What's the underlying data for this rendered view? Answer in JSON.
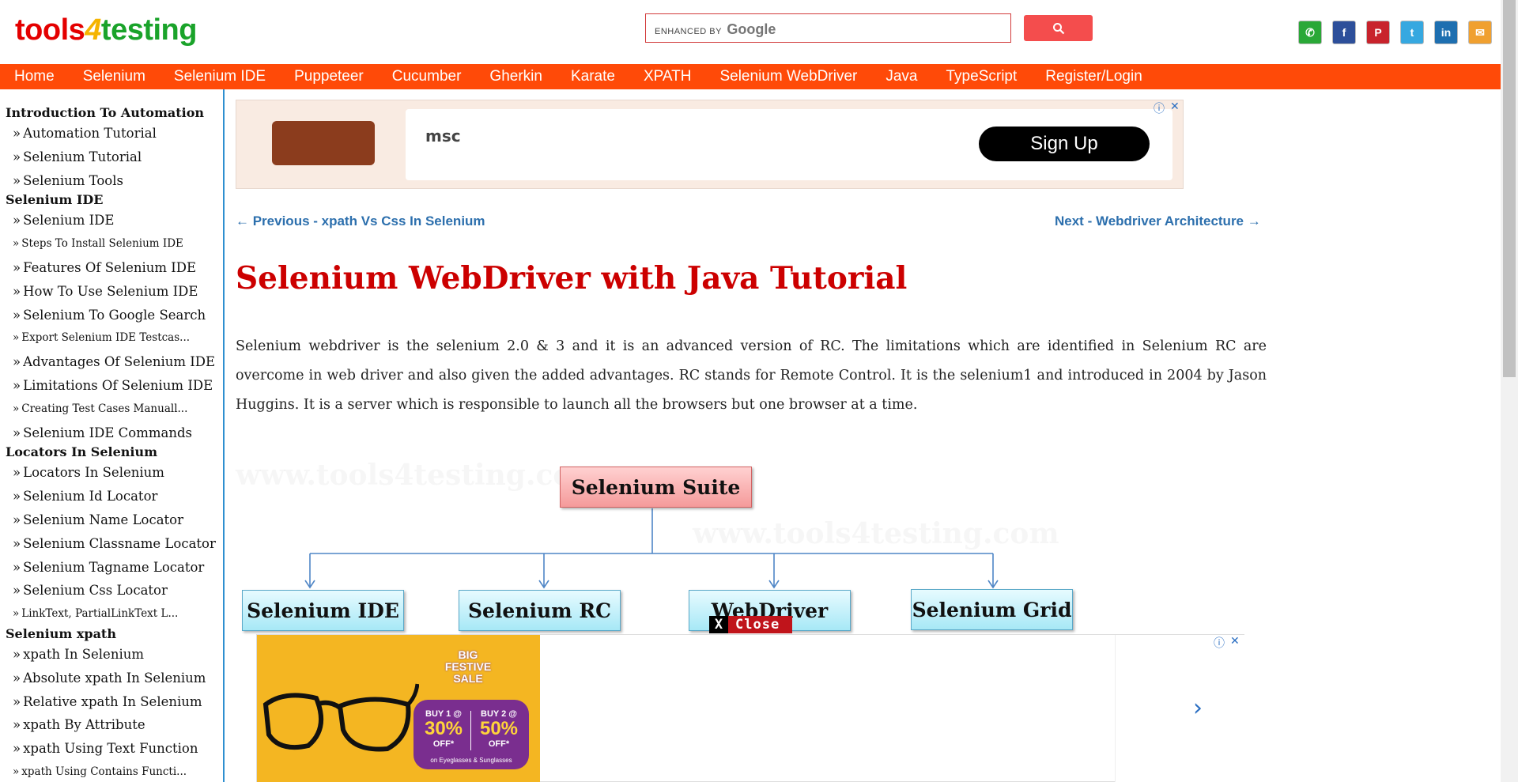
{
  "logo": {
    "part1": "tools",
    "part2": "4",
    "part3": "testing"
  },
  "search": {
    "brand_prefix": "ENHANCED BY",
    "brand_name": "Google",
    "value": ""
  },
  "social": [
    {
      "name": "whatsapp",
      "glyph": "✆",
      "color": "#2aa837"
    },
    {
      "name": "facebook",
      "glyph": "f",
      "color": "#2d4f9a"
    },
    {
      "name": "pinterest",
      "glyph": "P",
      "color": "#c8232c"
    },
    {
      "name": "twitter",
      "glyph": "t",
      "color": "#36a8e0"
    },
    {
      "name": "linkedin",
      "glyph": "in",
      "color": "#1e6fb0"
    },
    {
      "name": "email",
      "glyph": "✉",
      "color": "#f0a030"
    }
  ],
  "nav": [
    "Home",
    "Selenium",
    "Selenium IDE",
    "Puppeteer",
    "Cucumber",
    "Gherkin",
    "Karate",
    "XPATH",
    "Selenium WebDriver",
    "Java",
    "TypeScript",
    "Register/Login"
  ],
  "sidebar": {
    "groups": [
      {
        "heading": "Introduction To Automation",
        "items": [
          "Automation Tutorial",
          "Selenium Tutorial",
          "Selenium Tools"
        ]
      },
      {
        "heading": "Selenium IDE",
        "items": [
          "Selenium IDE",
          "Steps To Install Selenium IDE",
          "Features Of Selenium IDE",
          "How To Use Selenium IDE",
          "Selenium To Google Search",
          "Export Selenium IDE Testcas...",
          "Advantages Of Selenium IDE",
          "Limitations Of Selenium IDE",
          "Creating Test Cases Manuall...",
          "Selenium IDE Commands"
        ]
      },
      {
        "heading": "Locators In Selenium",
        "items": [
          "Locators In Selenium",
          "Selenium Id Locator",
          "Selenium Name Locator",
          "Selenium Classname Locator",
          "Selenium Tagname Locator",
          "Selenium Css Locator",
          "LinkText, PartialLinkText L..."
        ]
      },
      {
        "heading": "Selenium xpath",
        "items": [
          "xpath In Selenium",
          "Absolute xpath In Selenium",
          "Relative xpath In Selenium",
          "xpath By Attribute",
          "xpath Using Text Function",
          "xpath Using Contains Functi..."
        ]
      }
    ],
    "bullet": "»"
  },
  "top_ad": {
    "brand": "msc",
    "cta": "Sign Up"
  },
  "pager": {
    "prev": "← Previous - xpath Vs Css In Selenium",
    "next": "Next - Webdriver Architecture →"
  },
  "article": {
    "title": "Selenium WebDriver with Java Tutorial",
    "intro": "Selenium webdriver is the selenium 2.0 & 3 and it is an advanced version of RC. The limitations which are identified in Selenium RC are overcome in web driver and also given the added advantages. RC stands for Remote Control. It is the selenium1 and introduced in 2004 by Jason Huggins. It is a server which is responsible to launch all the browsers but one browser at a time."
  },
  "diagram": {
    "watermark": "www.tools4testing.com",
    "root": "Selenium Suite",
    "children": [
      "Selenium IDE",
      "Selenium RC",
      "WebDriver",
      "Selenium Grid"
    ]
  },
  "close_tag": {
    "x": "X",
    "label": "Close"
  },
  "bottom_ad": {
    "sale_line1": "BIG",
    "sale_line2": "FESTIVE",
    "sale_line3": "SALE",
    "offer1_buy": "BUY 1 @",
    "offer1_pct": "30%",
    "offer1_off": "OFF*",
    "offer2_buy": "BUY 2 @",
    "offer2_pct": "50%",
    "offer2_off": "OFF*",
    "offer_note": "on Eyeglasses & Sunglasses"
  },
  "ad_controls": {
    "info": "ⓘ",
    "close": "✕"
  }
}
